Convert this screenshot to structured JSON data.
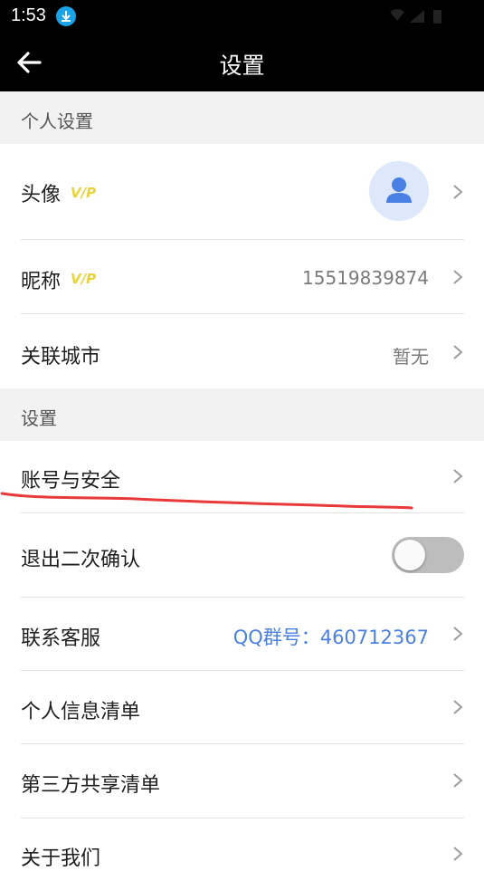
{
  "status_bar": {
    "time": "1:53"
  },
  "header": {
    "title": "设置"
  },
  "sections": {
    "personal": "个人设置",
    "settings": "设置"
  },
  "rows": {
    "avatar": {
      "label": "头像"
    },
    "nickname": {
      "label": "昵称",
      "value": "15519839874"
    },
    "city": {
      "label": "关联城市",
      "value": "暂无"
    },
    "account": {
      "label": "账号与安全"
    },
    "exit_confirm": {
      "label": "退出二次确认",
      "toggle_on": false
    },
    "support": {
      "label": "联系客服",
      "value": "QQ群号：460712367"
    },
    "personal_info": {
      "label": "个人信息清单"
    },
    "third_party": {
      "label": "第三方共享清单"
    },
    "about": {
      "label": "关于我们"
    }
  },
  "colors": {
    "accent_link": "#4a7fe3",
    "vip": "#e8d43a",
    "annotation": "#e83a3a"
  }
}
